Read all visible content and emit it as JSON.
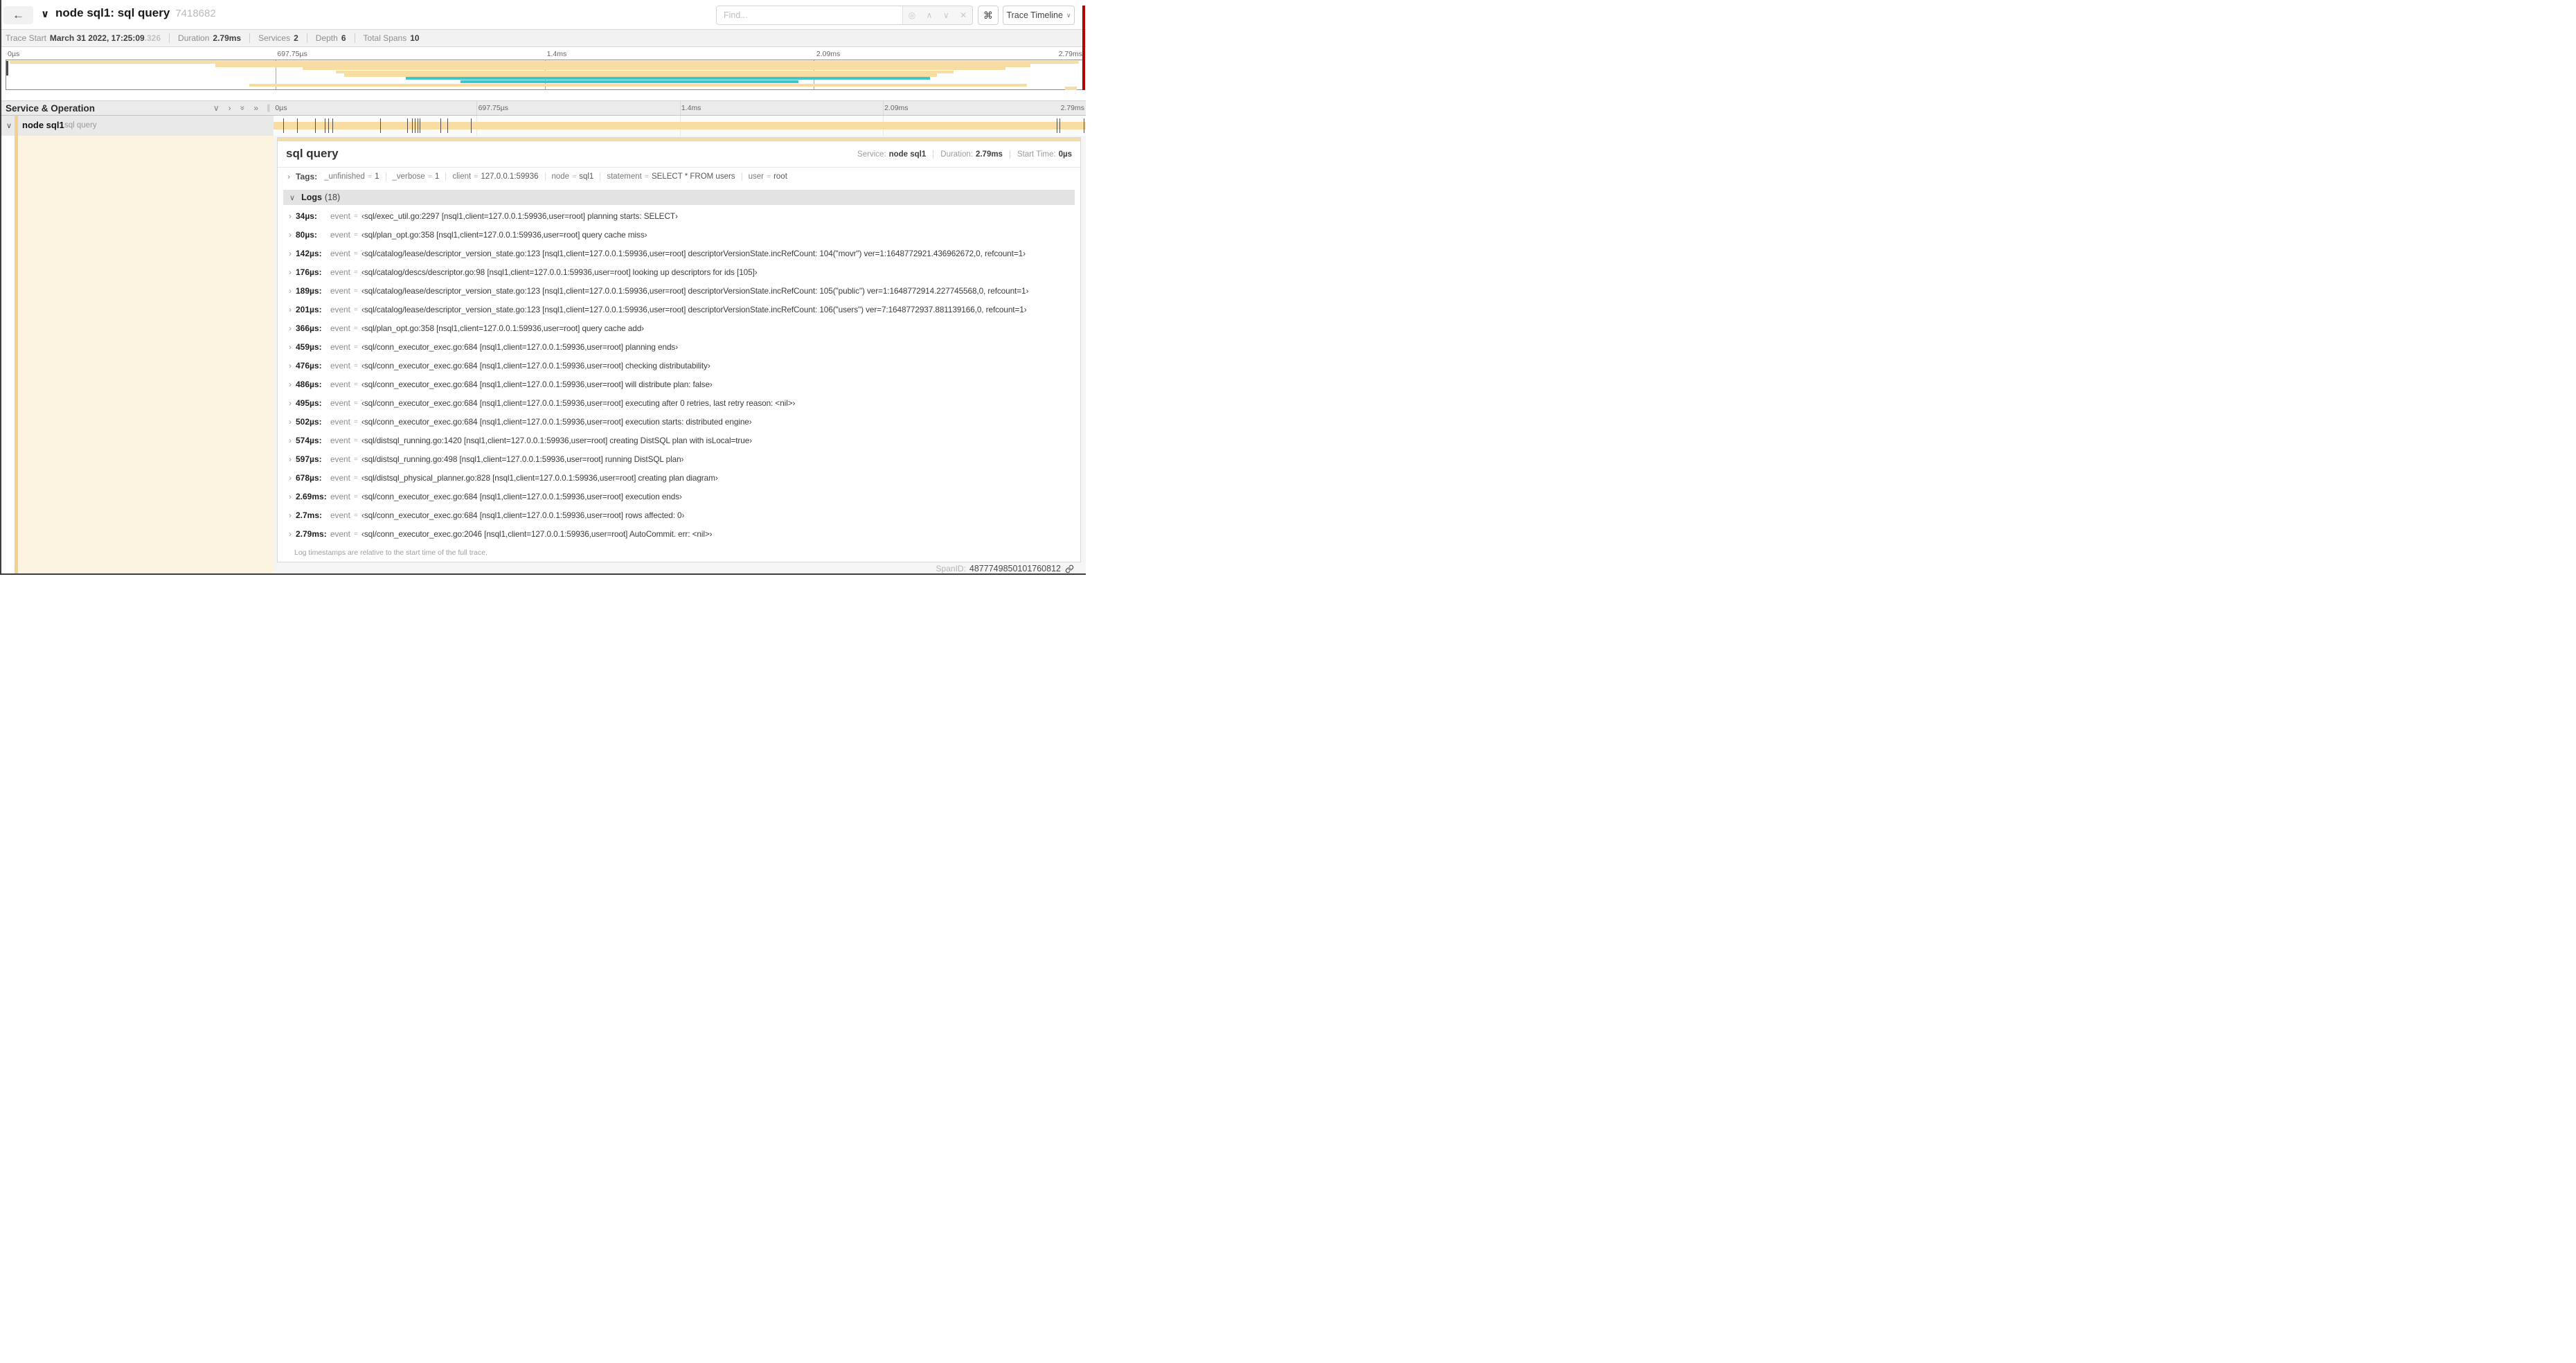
{
  "header": {
    "back_label": "←",
    "collapse_chevron": "∨",
    "title": "node sql1: sql query",
    "trace_id": "7418682",
    "find_placeholder": "Find...",
    "find_icons": {
      "locate": "◎",
      "prev": "∧",
      "next": "∨",
      "clear": "✕"
    },
    "keyboard_shortcut_icon": "⌘",
    "view_select_label": "Trace Timeline",
    "view_select_chevron": "∨"
  },
  "stats": [
    {
      "label": "Trace Start",
      "value": "March 31 2022, 17:25:09",
      "suffix": ".326"
    },
    {
      "label": "Duration",
      "value": "2.79ms"
    },
    {
      "label": "Services",
      "value": "2"
    },
    {
      "label": "Depth",
      "value": "6"
    },
    {
      "label": "Total Spans",
      "value": "10"
    }
  ],
  "timeline": {
    "duration_us": 2790,
    "ticks": [
      {
        "label": "0µs",
        "pos": 0
      },
      {
        "label": "697.75µs",
        "pos": 25
      },
      {
        "label": "1.4ms",
        "pos": 50
      },
      {
        "label": "2.09ms",
        "pos": 75
      },
      {
        "label": "2.79ms",
        "pos": 100
      }
    ]
  },
  "colors": {
    "span_tan": "#f7dda1",
    "span_teal": "#41c4c9",
    "stripe_tan": "#f2d28e",
    "row_tint": "#fcf3e0"
  },
  "minimap": {
    "rows": [
      {
        "l": 0.3,
        "r": 99.6,
        "c": "span_tan"
      },
      {
        "l": 19.4,
        "r": 95.1,
        "c": "span_tan"
      },
      {
        "l": 27.5,
        "r": 92.8,
        "c": "span_tan"
      },
      {
        "l": 30.6,
        "r": 88.0,
        "c": "span_tan"
      },
      {
        "l": 31.4,
        "r": 86.4,
        "c": "span_tan"
      },
      {
        "l": 37.1,
        "r": 85.8,
        "c": "span_teal"
      },
      {
        "l": 42.2,
        "r": 73.6,
        "c": "span_teal"
      },
      {
        "l": 22.6,
        "r": 94.8,
        "c": "span_tan"
      },
      {
        "l": 98.3,
        "r": 99.4,
        "c": "span_tan"
      }
    ]
  },
  "grid": {
    "header_title": "Service & Operation",
    "icons": {
      "collapse_one": "∨",
      "expand_one": "›",
      "collapse_all": "»",
      "expand_all": "»"
    },
    "resizer": "∥"
  },
  "span_row": {
    "chevron": "∨",
    "service": "node sql1",
    "operation": "sql query"
  },
  "detail": {
    "title": "sql query",
    "meta": [
      {
        "label": "Service:",
        "value": "node sql1"
      },
      {
        "label": "Duration:",
        "value": "2.79ms"
      },
      {
        "label": "Start Time:",
        "value": "0µs"
      }
    ],
    "tags_chevron": "›",
    "tags_label": "Tags:",
    "tags": [
      {
        "key": "_unfinished",
        "value": "1"
      },
      {
        "key": "_verbose",
        "value": "1"
      },
      {
        "key": "client",
        "value": "127.0.0.1:59936"
      },
      {
        "key": "node",
        "value": "sql1"
      },
      {
        "key": "statement",
        "value": "SELECT * FROM users"
      },
      {
        "key": "user",
        "value": "root"
      }
    ],
    "logs_chevron": "∨",
    "logs_label": "Logs",
    "logs_count": "(18)",
    "logs": [
      {
        "t": "34µs:",
        "us": 34,
        "f": "event",
        "v": "‹sql/exec_util.go:2297 [nsql1,client=127.0.0.1:59936,user=root] planning starts: SELECT›"
      },
      {
        "t": "80µs:",
        "us": 80,
        "f": "event",
        "v": "‹sql/plan_opt.go:358 [nsql1,client=127.0.0.1:59936,user=root] query cache miss›"
      },
      {
        "t": "142µs:",
        "us": 142,
        "f": "event",
        "v": "‹sql/catalog/lease/descriptor_version_state.go:123 [nsql1,client=127.0.0.1:59936,user=root] descriptorVersionState.incRefCount: 104(\"movr\") ver=1:1648772921.436962672,0, refcount=1›"
      },
      {
        "t": "176µs:",
        "us": 176,
        "f": "event",
        "v": "‹sql/catalog/descs/descriptor.go:98 [nsql1,client=127.0.0.1:59936,user=root] looking up descriptors for ids [105]›"
      },
      {
        "t": "189µs:",
        "us": 189,
        "f": "event",
        "v": "‹sql/catalog/lease/descriptor_version_state.go:123 [nsql1,client=127.0.0.1:59936,user=root] descriptorVersionState.incRefCount: 105(\"public\") ver=1:1648772914.227745568,0, refcount=1›"
      },
      {
        "t": "201µs:",
        "us": 201,
        "f": "event",
        "v": "‹sql/catalog/lease/descriptor_version_state.go:123 [nsql1,client=127.0.0.1:59936,user=root] descriptorVersionState.incRefCount: 106(\"users\") ver=7:1648772937.881139166,0, refcount=1›"
      },
      {
        "t": "366µs:",
        "us": 366,
        "f": "event",
        "v": "‹sql/plan_opt.go:358 [nsql1,client=127.0.0.1:59936,user=root] query cache add›"
      },
      {
        "t": "459µs:",
        "us": 459,
        "f": "event",
        "v": "‹sql/conn_executor_exec.go:684 [nsql1,client=127.0.0.1:59936,user=root] planning ends›"
      },
      {
        "t": "476µs:",
        "us": 476,
        "f": "event",
        "v": "‹sql/conn_executor_exec.go:684 [nsql1,client=127.0.0.1:59936,user=root] checking distributability›"
      },
      {
        "t": "486µs:",
        "us": 486,
        "f": "event",
        "v": "‹sql/conn_executor_exec.go:684 [nsql1,client=127.0.0.1:59936,user=root] will distribute plan: false›"
      },
      {
        "t": "495µs:",
        "us": 495,
        "f": "event",
        "v": "‹sql/conn_executor_exec.go:684 [nsql1,client=127.0.0.1:59936,user=root] executing after 0 retries, last retry reason: <nil>›"
      },
      {
        "t": "502µs:",
        "us": 502,
        "f": "event",
        "v": "‹sql/conn_executor_exec.go:684 [nsql1,client=127.0.0.1:59936,user=root] execution starts: distributed engine›"
      },
      {
        "t": "574µs:",
        "us": 574,
        "f": "event",
        "v": "‹sql/distsql_running.go:1420 [nsql1,client=127.0.0.1:59936,user=root] creating DistSQL plan with isLocal=true›"
      },
      {
        "t": "597µs:",
        "us": 597,
        "f": "event",
        "v": "‹sql/distsql_running.go:498 [nsql1,client=127.0.0.1:59936,user=root] running DistSQL plan›"
      },
      {
        "t": "678µs:",
        "us": 678,
        "f": "event",
        "v": "‹sql/distsql_physical_planner.go:828 [nsql1,client=127.0.0.1:59936,user=root] creating plan diagram›"
      },
      {
        "t": "2.69ms:",
        "us": 2690,
        "f": "event",
        "v": "‹sql/conn_executor_exec.go:684 [nsql1,client=127.0.0.1:59936,user=root] execution ends›"
      },
      {
        "t": "2.7ms:",
        "us": 2700,
        "f": "event",
        "v": "‹sql/conn_executor_exec.go:684 [nsql1,client=127.0.0.1:59936,user=root] rows affected: 0›"
      },
      {
        "t": "2.79ms:",
        "us": 2790,
        "f": "event",
        "v": "‹sql/conn_executor_exec.go:2046 [nsql1,client=127.0.0.1:59936,user=root] AutoCommit. err: <nil>›"
      }
    ],
    "logs_footnote": "Log timestamps are relative to the start time of the full trace.",
    "spanid_label": "SpanID:",
    "spanid_value": "4877749850101760812"
  }
}
